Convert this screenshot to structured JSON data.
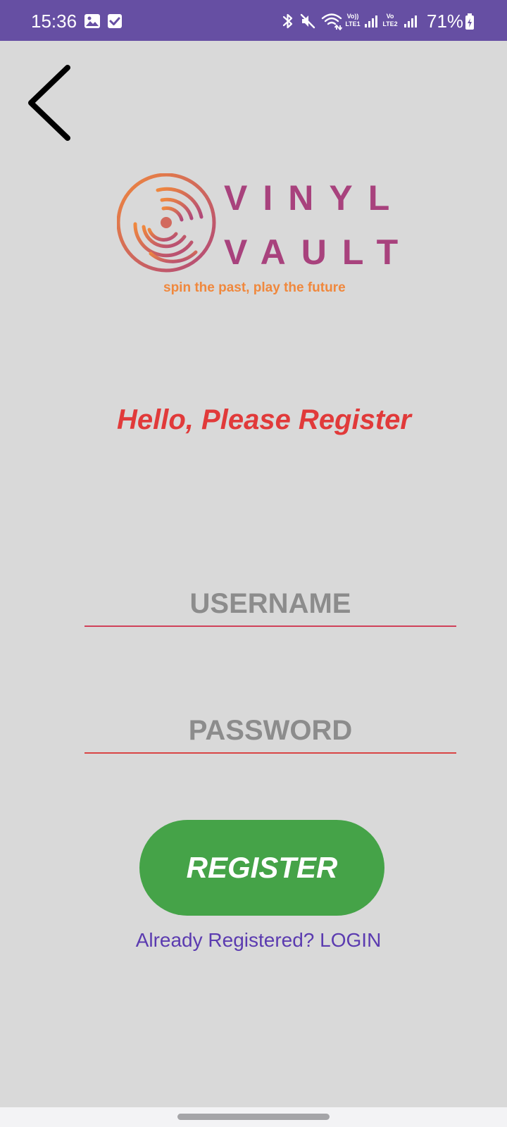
{
  "status_bar": {
    "time": "15:36",
    "battery": "71%",
    "sim1_label_top": "Vo))",
    "sim1_label_bottom": "LTE1",
    "sim2_label_top": "Vo",
    "sim2_label_bottom": "LTE2",
    "background_color": "#664fa3",
    "icons": [
      "gallery-icon",
      "checkbox-icon",
      "bluetooth-icon",
      "mute-icon",
      "wifi-icon",
      "signal-icon",
      "signal-icon",
      "battery-icon"
    ]
  },
  "navigation": {
    "back_icon": "chevron-left-icon"
  },
  "logo": {
    "line1": "VINYL",
    "line2": "VAULT",
    "tagline": "spin the past, play the future",
    "primary_color": "#a8427d",
    "accent_color": "#f0883d"
  },
  "greeting": {
    "text": "Hello, Please Register",
    "color": "#e13a3a"
  },
  "form": {
    "username_placeholder": "USERNAME",
    "username_value": "",
    "password_placeholder": "PASSWORD",
    "password_value": ""
  },
  "register_button": {
    "label": "REGISTER",
    "color": "#45a348"
  },
  "login_link": {
    "text": "Already Registered? LOGIN",
    "color": "#5b3bb0"
  }
}
